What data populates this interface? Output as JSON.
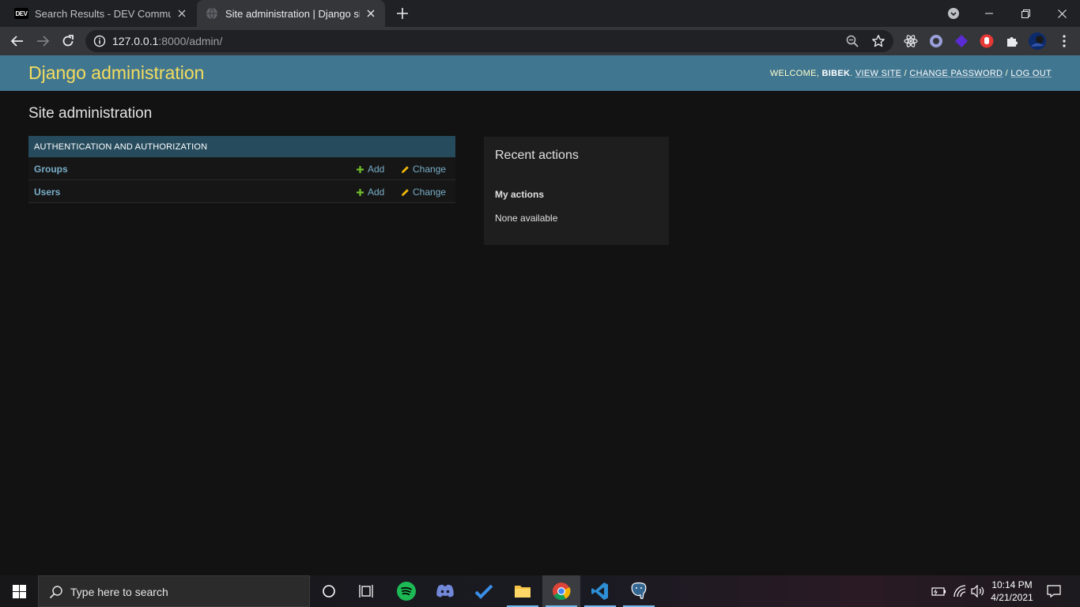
{
  "browser": {
    "tabs": [
      {
        "title": "Search Results - DEV Community",
        "favicon": "DEV",
        "active": false
      },
      {
        "title": "Site administration | Django site admin",
        "active": true
      }
    ],
    "address": {
      "host": "127.0.0.1",
      "rest": ":8000/admin/"
    }
  },
  "admin": {
    "branding": "Django administration",
    "usertools": {
      "welcome": "WELCOME,",
      "username": "BIBEK",
      "view_site": "VIEW SITE",
      "change_password": "CHANGE PASSWORD",
      "logout": "LOG OUT",
      "sep": "/"
    },
    "title": "Site administration",
    "app_module": {
      "caption": "AUTHENTICATION AND AUTHORIZATION",
      "models": [
        {
          "name": "Groups",
          "add": "Add",
          "change": "Change"
        },
        {
          "name": "Users",
          "add": "Add",
          "change": "Change"
        }
      ]
    },
    "recent_actions": {
      "title": "Recent actions",
      "my_actions": "My actions",
      "empty": "None available"
    }
  },
  "taskbar": {
    "search_placeholder": "Type here to search",
    "time": "10:14 PM",
    "date": "4/21/2021"
  },
  "colors": {
    "header_bg": "#417690",
    "branding": "#f5dd5d",
    "caption_bg": "#264b5d",
    "link": "#79aec8",
    "add_icon": "#70bf2b",
    "change_icon": "#efb80b"
  }
}
